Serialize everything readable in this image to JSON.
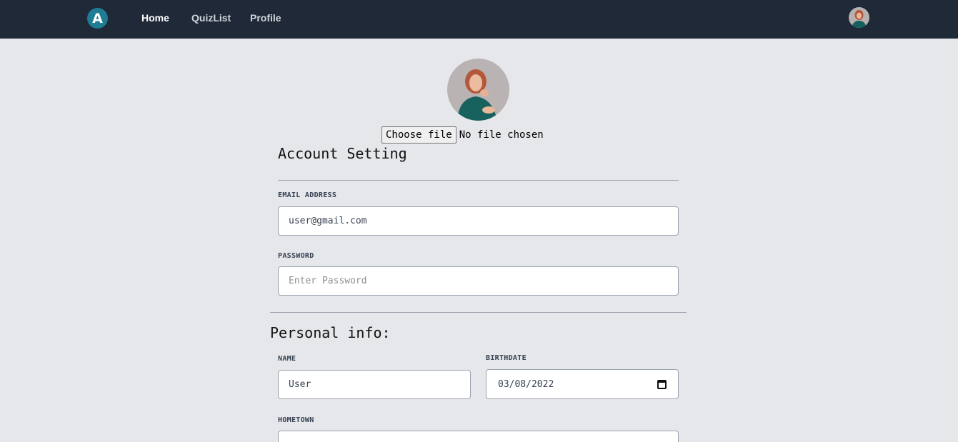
{
  "nav": {
    "logo_letter": "A",
    "links": [
      {
        "label": "Home",
        "active": true
      },
      {
        "label": "QuizList",
        "active": false
      },
      {
        "label": "Profile",
        "active": false
      }
    ]
  },
  "upload": {
    "button_label": "Choose file",
    "status": "No file chosen"
  },
  "account": {
    "title": "Account Setting",
    "email_label": "EMAIL ADDRESS",
    "email_value": "user@gmail.com",
    "password_label": "PASSWORD",
    "password_placeholder": "Enter Password"
  },
  "personal": {
    "title": "Personal info:",
    "name_label": "NAME",
    "name_value": "User",
    "birthdate_label": "BIRTHDATE",
    "birthdate_value": "03/08/2022",
    "hometown_label": "HOMETOWN"
  },
  "colors": {
    "navbar": "#1f2937",
    "logo": "#1e7d94",
    "page_background": "#e5e7eb"
  }
}
